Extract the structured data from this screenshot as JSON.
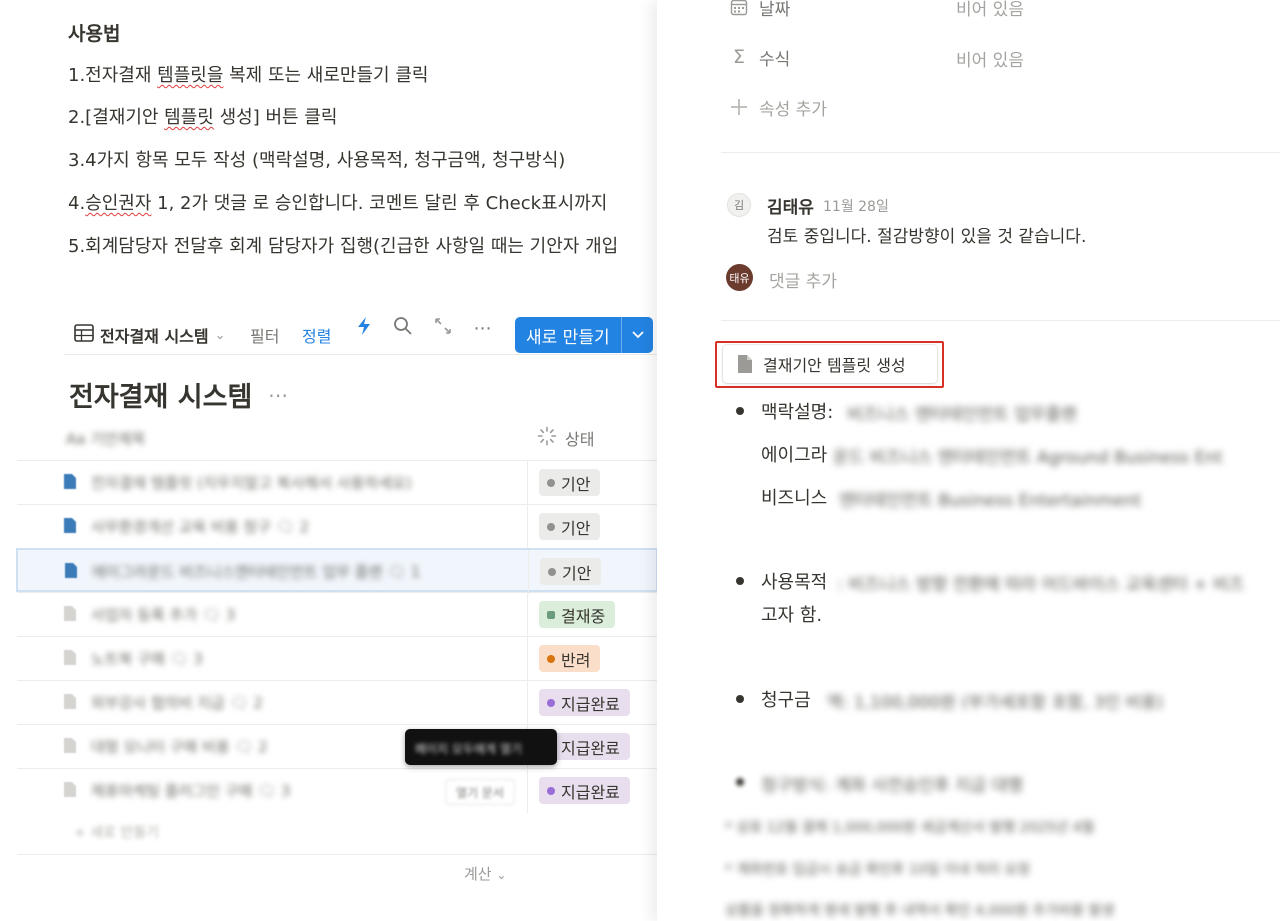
{
  "howto": {
    "title": "사용법",
    "step1_pre": "1.전자결재 ",
    "step1_sq": "템플릿을",
    "step1_post": " 복제 또는 새로만들기 클릭",
    "step2_pre": "2.[결재기안 ",
    "step2_sq": "템플릿",
    "step2_post": " 생성] 버튼 클릭",
    "step3": "3.4가지 항목 모두 작성 (맥락설명, 사용목적, 청구금액, 청구방식)",
    "step4_pre": "4.",
    "step4_sq": "승인권자",
    "step4_post": " 1, 2가 댓글 로 승인합니다. 코멘트 달린 후 Check표시까지",
    "step5": "5.회계담당자 전달후 회계 담당자가 집행(긴급한 사항일 때는 기안자 개입"
  },
  "toolbar": {
    "view_label": "전자결재 시스템",
    "filter_label": "필터",
    "sort_label": "정렬",
    "new_label": "새로 만들기"
  },
  "database": {
    "title": "전자결재 시스템",
    "col_name": "Aa 기안제목",
    "col_status": "상태",
    "rows": [
      {
        "name": "전자결재 템플릿 (지우지말고 복사해서 사용하세요)",
        "comments": "",
        "status": "기안",
        "filled": true
      },
      {
        "name": "사무환경개선 교육 비용 청구",
        "comments": "2",
        "status": "기안",
        "filled": true
      },
      {
        "name": "에이그라운드 비즈니스엔터테인먼트 업무 플랜",
        "comments": "1",
        "status": "기안",
        "filled": true
      },
      {
        "name": "사업자 등록 추가",
        "comments": "3",
        "status": "결재중",
        "filled": false
      },
      {
        "name": "노트북 구매",
        "comments": "3",
        "status": "반려",
        "filled": false
      },
      {
        "name": "외부강사 협의비 지급",
        "comments": "2",
        "status": "지급완료",
        "filled": false
      },
      {
        "name": "대형 모니터 구매 비용",
        "comments": "2",
        "status": "지급완료",
        "filled": false
      },
      {
        "name": "제휴마케팅 플러그인 구매",
        "comments": "3",
        "status": "지급완료",
        "filled": false
      }
    ],
    "tooltip": "페이지 모두에게 열기",
    "open_label": "열기 문서",
    "add_row": "+ 새로 만들기",
    "calc": "계산"
  },
  "colors": {
    "accent": "#2383e2",
    "status_draft_bg": "#ebebea",
    "status_draft_dot": "#91918e",
    "status_progress_bg": "#dbeddb",
    "status_progress_dot": "#6c9b7d",
    "status_reject_bg": "#fadec9",
    "status_reject_dot": "#d9730d",
    "status_done_bg": "#e8deee",
    "status_done_dot": "#9a6dd7",
    "highlight_border": "#d93025"
  },
  "props": {
    "date_label": "날짜",
    "date_value": "비어 있음",
    "formula_label": "수식",
    "formula_value": "비어 있음",
    "add_label": "속성 추가"
  },
  "comment": {
    "author_initial": "김",
    "author": "김태유",
    "date": "11월 28일",
    "text": "검토 중입니다. 절감방향이 있을 것 같습니다.",
    "me_initial": "태유",
    "add_placeholder": "댓글 추가"
  },
  "template_button": "결재기안 템플릿 생성",
  "doc": {
    "context_label": "맥락설명:",
    "context_value": "비즈니스 엔터테인먼트 업무플랜",
    "context_line2_pre": "에이그라",
    "context_line2_blur": "운드 비즈니스 엔터테인먼트 Aground Business Ent",
    "context_line3_pre": "비즈니스",
    "context_line3_blur": "엔터테인먼트 Business Entertainment",
    "purpose_label": "사용목적",
    "purpose_value": ": 비즈니스 방향 전환에 따라 어드바이스 교육센터 + 비즈",
    "purpose_line2": "고자 함.",
    "amount_label": "청구금",
    "amount_value": "액: 1,100,000원 (부가세포함 포함, 3인 비용)",
    "method_line": "청구방식: 계좌 사전승인후 지급 대행",
    "note1": "* 상호 12월 결제 1,000,000원 세금계산서 발행 2025년 4월",
    "note2": "* 계좌번호 입금시 송금 확인후 10일 이내 처리 요청",
    "note3": "상품을 정확하게 명세 발행 후 내역서 확인 4,000원 추가비용 발생"
  }
}
